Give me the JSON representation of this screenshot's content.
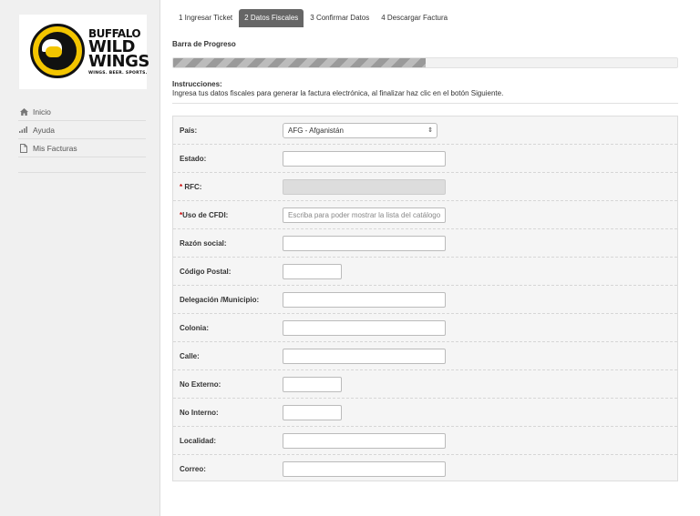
{
  "brand": {
    "logo_line1": "BUFFALO",
    "logo_line2": "WILD",
    "logo_line3": "WINGS",
    "logo_tagline": "WINGS. BEER. SPORTS."
  },
  "sidebar": {
    "items": [
      {
        "label": "Inicio",
        "icon": "home-icon"
      },
      {
        "label": "Ayuda",
        "icon": "signal-bars-icon"
      },
      {
        "label": "Mis Facturas",
        "icon": "document-icon"
      }
    ]
  },
  "tabs": [
    {
      "label": "1 Ingresar Ticket",
      "active": false
    },
    {
      "label": "2 Datos Fiscales",
      "active": true
    },
    {
      "label": "3 Confirmar Datos",
      "active": false
    },
    {
      "label": "4 Descargar Factura",
      "active": false
    }
  ],
  "progress": {
    "label": "Barra de Progreso",
    "value": 0.5
  },
  "instructions": {
    "title": "Instrucciones:",
    "text": "Ingresa tus datos fiscales para generar la factura electrónica, al finalizar haz clic en el botón Siguiente."
  },
  "form": {
    "pais": {
      "label": "País:",
      "value": "AFG - Afganistán"
    },
    "estado": {
      "label": "Estado:",
      "value": ""
    },
    "rfc": {
      "label": "RFC:",
      "required_mark": "*",
      "value": ""
    },
    "uso_cfdi": {
      "label": "Uso de CFDI:",
      "required_mark": "*",
      "placeholder": "Escriba para poder mostrar la lista del catálogo."
    },
    "razon_social": {
      "label": "Razón social:",
      "value": ""
    },
    "codigo_postal": {
      "label": "Código Postal:",
      "value": ""
    },
    "delegacion": {
      "label": "Delegación /Municipio:",
      "value": ""
    },
    "colonia": {
      "label": "Colonia:",
      "value": ""
    },
    "calle": {
      "label": "Calle:",
      "value": ""
    },
    "no_externo": {
      "label": "No Externo:",
      "value": ""
    },
    "no_interno": {
      "label": "No Interno:",
      "value": ""
    },
    "localidad": {
      "label": "Localidad:",
      "value": ""
    },
    "correo": {
      "label": "Correo:",
      "value": ""
    }
  },
  "colors": {
    "active_tab": "#666666",
    "required": "#cc0000",
    "logo_yellow": "#f3c500"
  }
}
